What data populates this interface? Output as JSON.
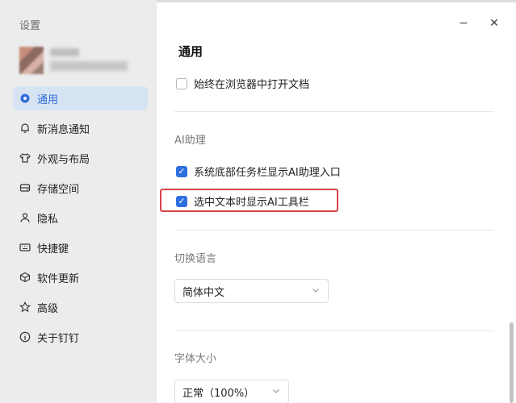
{
  "sidebar": {
    "title": "设置",
    "items": [
      {
        "label": "通用",
        "icon": "gear-icon",
        "active": true
      },
      {
        "label": "新消息通知",
        "icon": "bell-icon",
        "active": false
      },
      {
        "label": "外观与布局",
        "icon": "shirt-icon",
        "active": false
      },
      {
        "label": "存储空间",
        "icon": "storage-icon",
        "active": false
      },
      {
        "label": "隐私",
        "icon": "person-icon",
        "active": false
      },
      {
        "label": "快捷键",
        "icon": "keyboard-icon",
        "active": false
      },
      {
        "label": "软件更新",
        "icon": "cube-icon",
        "active": false
      },
      {
        "label": "高级",
        "icon": "star-icon",
        "active": false
      },
      {
        "label": "关于钉钉",
        "icon": "info-icon",
        "active": false
      }
    ]
  },
  "window": {
    "minimize_glyph": "−",
    "close_glyph": "✕"
  },
  "main": {
    "section_title": "通用",
    "open_in_browser": {
      "label": "始终在浏览器中打开文档",
      "checked": false
    },
    "ai_group": {
      "label": "AI助理",
      "taskbar_entry": {
        "label": "系统底部任务栏显示AI助理入口",
        "checked": true
      },
      "toolbar_on_select": {
        "label": "选中文本时显示AI工具栏",
        "checked": true
      }
    },
    "language": {
      "label": "切换语言",
      "value": "简体中文"
    },
    "font_size": {
      "label": "字体大小",
      "value": "正常（100%）"
    }
  },
  "colors": {
    "accent": "#2e6fe0",
    "active_bg": "#d6e3f3",
    "highlight_border": "#d9434a",
    "sidebar_bg": "#ececec"
  }
}
